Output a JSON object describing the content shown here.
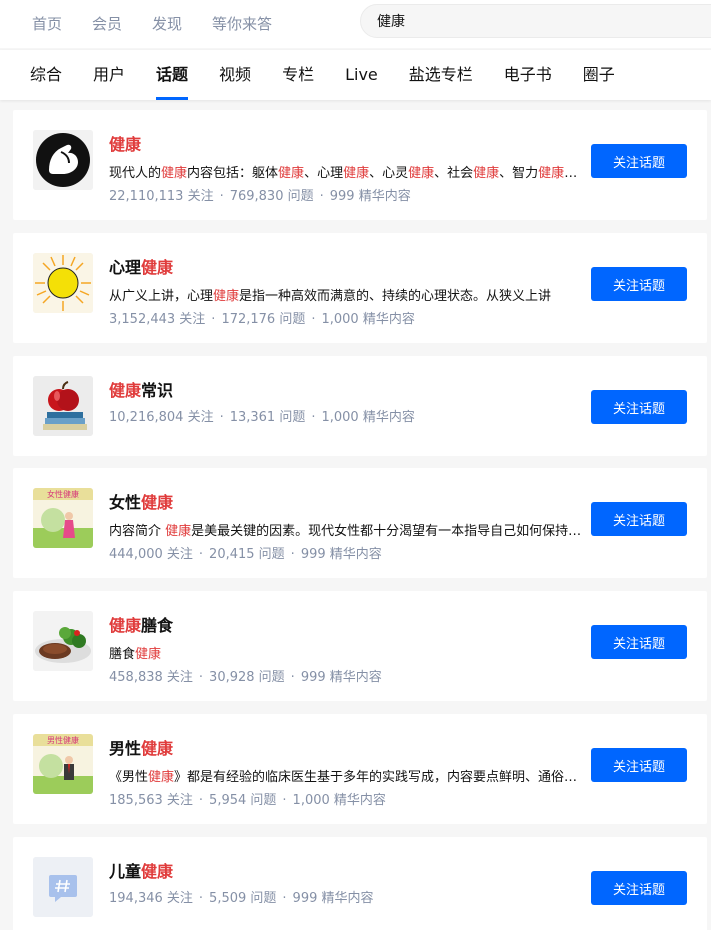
{
  "top_nav": [
    "首页",
    "会员",
    "发现",
    "等你来答"
  ],
  "search": {
    "value": "健康"
  },
  "tabs": [
    "综合",
    "用户",
    "话题",
    "视频",
    "专栏",
    "Live",
    "盐选专栏",
    "电子书",
    "圈子"
  ],
  "active_tab": "话题",
  "labels": {
    "follow_button": "关注话题",
    "sep": "·"
  },
  "colors": {
    "accent": "#0066ff",
    "highlight": "#e03c3c",
    "meta": "#8590a6"
  },
  "topics": [
    {
      "title": [
        "健康"
      ],
      "desc": "现代人的健康内容包括：躯体健康、心理健康、心灵健康、社会健康、智力健康、道德健康、环境健康等。",
      "stats": [
        "22,110,113 关注",
        "769,830 问题",
        "999 精华内容"
      ],
      "icon": "muscle-arm-icon"
    },
    {
      "title": [
        "心理",
        "健康"
      ],
      "desc": "从广义上讲，心理健康是指一种高效而满意的、持续的心理状态。从狭义上讲",
      "stats": [
        "3,152,443 关注",
        "172,176 问题",
        "1,000 精华内容"
      ],
      "icon": "sun-icon"
    },
    {
      "title": [
        "健康",
        "常识"
      ],
      "desc": "",
      "stats": [
        "10,216,804 关注",
        "13,361 问题",
        "1,000 精华内容"
      ],
      "icon": "apple-books-icon"
    },
    {
      "title": [
        "女性",
        "健康"
      ],
      "desc": "内容简介 健康是美最关键的因素。现代女性都十分渴望有一本指导自己如何保持健康的书",
      "stats": [
        "444,000 关注",
        "20,415 问题",
        "999 精华内容"
      ],
      "icon": "women-health-book-icon",
      "thumb_text": "女性健康"
    },
    {
      "title": [
        "健康",
        "膳食"
      ],
      "desc": "膳食健康",
      "stats": [
        "458,838 关注",
        "30,928 问题",
        "999 精华内容"
      ],
      "icon": "meal-plate-icon"
    },
    {
      "title": [
        "男性",
        "健康"
      ],
      "desc": "《男性健康》都是有经验的临床医生基于多年的实践写成，内容要点鲜明、通俗易懂",
      "stats": [
        "185,563 关注",
        "5,954 问题",
        "1,000 精华内容"
      ],
      "icon": "men-health-book-icon",
      "thumb_text": "男性健康"
    },
    {
      "title": [
        "儿童",
        "健康"
      ],
      "desc": "",
      "stats": [
        "194,346 关注",
        "5,509 问题",
        "999 精华内容"
      ],
      "icon": "topic-hash-icon"
    }
  ]
}
